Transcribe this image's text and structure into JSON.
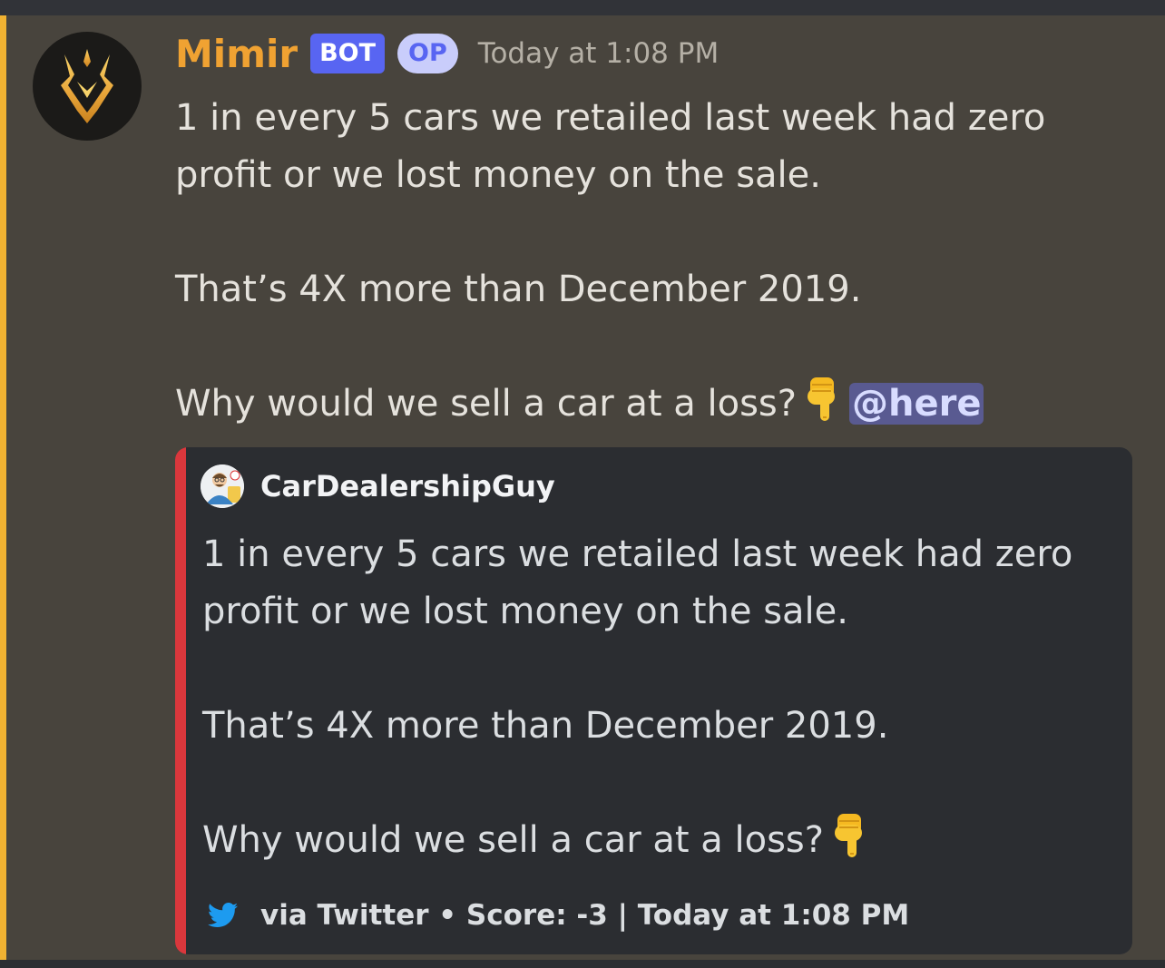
{
  "message": {
    "author": "Mimir",
    "bot_tag": "BOT",
    "op_tag": "OP",
    "timestamp": "Today at 1:08 PM",
    "lines": [
      "1 in every 5 cars we retailed last week had zero",
      "profit or we lost money on the sale.",
      "That’s 4X more than December 2019.",
      "Why would we sell a car at a loss?"
    ],
    "mention": "@here",
    "accent_color": "#f0b232",
    "author_color": "#f0a232"
  },
  "embed": {
    "author_name": "CarDealershipGuy",
    "lines": [
      "1 in every 5 cars we retailed last week had zero",
      "profit or we lost money on the sale.",
      "That’s 4X more than December 2019.",
      "Why would we sell a car at a loss?"
    ],
    "footer": "via Twitter • Score: -3 | Today at 1:08 PM",
    "color": "#da373c"
  },
  "icons": {
    "avatar": "mimir-logo-icon",
    "pointing": "backhand-index-pointing-down-icon",
    "footer": "twitter-bird-icon"
  }
}
